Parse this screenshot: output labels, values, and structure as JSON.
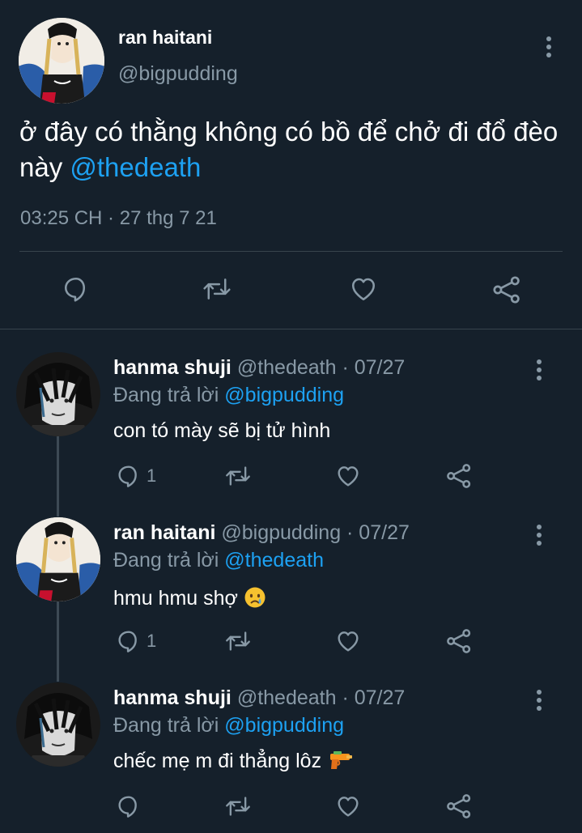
{
  "colors": {
    "background": "#15202b",
    "accent": "#1da1f2",
    "muted": "#8899a6",
    "divider": "#38444d"
  },
  "main_tweet": {
    "author_name": "ran haitani",
    "handle": "@bigpudding",
    "text": "ở đây có thằng không có bồ để chở đi đổ đèo này ",
    "mention": "@thedeath",
    "timestamp": "03:25 CH · 27 thg 7 21",
    "actions": [
      "reply-icon",
      "retweet-icon",
      "like-icon",
      "share-icon"
    ]
  },
  "replies": [
    {
      "author_name": "hanma shuji",
      "handle_date": "@thedeath · 07/27",
      "replying_prefix": "Đang trả lời ",
      "replying_to": "@bigpudding",
      "text": "con tó mày sẽ bị tử hình",
      "reply_count": "1"
    },
    {
      "author_name": "ran haitani",
      "handle_date": "@bigpudding · 07/27",
      "replying_prefix": "Đang trả lời ",
      "replying_to": "@thedeath",
      "text": "hmu hmu shợ ",
      "emoji": "crying-face-emoji",
      "reply_count": "1"
    },
    {
      "author_name": "hanma shuji",
      "handle_date": "@thedeath · 07/27",
      "replying_prefix": "Đang trả lời ",
      "replying_to": "@bigpudding",
      "text": "chếc mẹ m đi thẳng lôz ",
      "emoji": "water-pistol-emoji",
      "reply_count": ""
    }
  ]
}
